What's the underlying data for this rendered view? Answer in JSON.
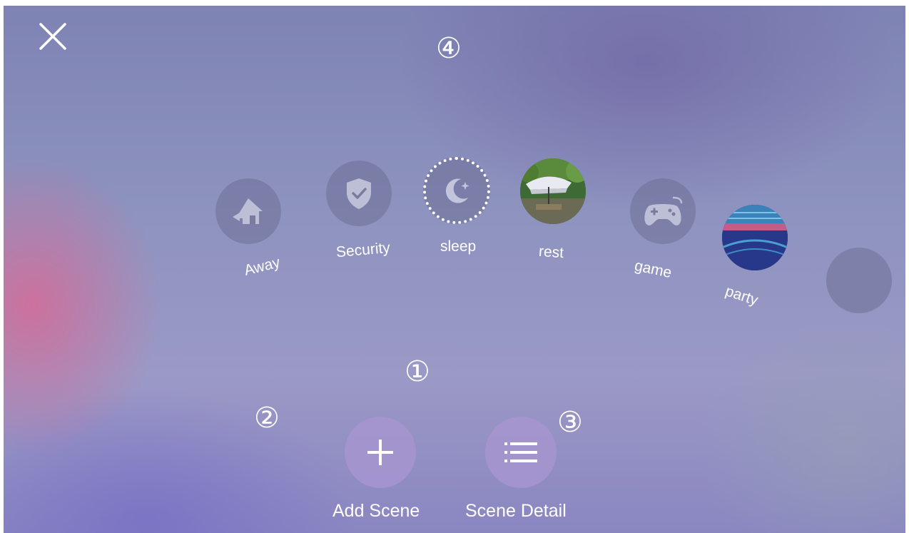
{
  "header": {
    "close_icon": "close-icon",
    "marker_top": "④"
  },
  "markers": {
    "one": "①",
    "two": "②",
    "three": "③"
  },
  "scenes": [
    {
      "label": "Away",
      "icon": "home-leave-icon"
    },
    {
      "label": "Security",
      "icon": "shield-check-icon"
    },
    {
      "label": "sleep",
      "icon": "moon-star-icon",
      "selected": true
    },
    {
      "label": "rest",
      "icon": "umbrella-photo"
    },
    {
      "label": "game",
      "icon": "gamepad-icon"
    },
    {
      "label": "party",
      "icon": "party-photo"
    },
    {
      "label": "",
      "icon": "empty-scene"
    }
  ],
  "actions": {
    "add_label": "Add Scene",
    "add_icon": "plus-icon",
    "detail_label": "Scene Detail",
    "detail_icon": "list-icon"
  },
  "colors": {
    "accent_circle": "#a998d2",
    "icon_disc": "#6e7096",
    "text": "#ffffff"
  }
}
